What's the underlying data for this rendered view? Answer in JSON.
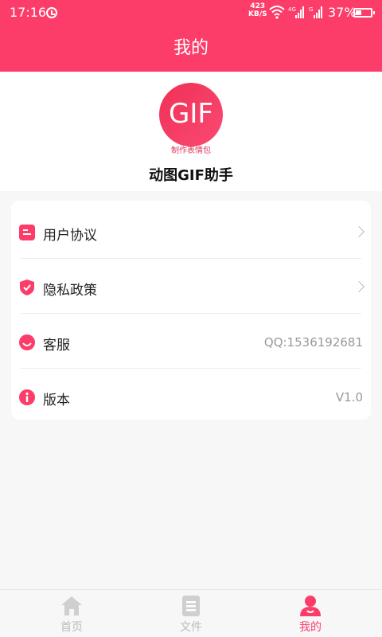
{
  "status_bar": {
    "time": "17:16",
    "net_speed_value": "423",
    "net_speed_unit": "KB/S",
    "signal_1_label": "4G",
    "signal_2_label": "G",
    "battery": "37%"
  },
  "header": {
    "title": "我的"
  },
  "profile": {
    "logo_text": "GIF",
    "logo_caption": "制作表情包",
    "app_name": "动图GIF助手"
  },
  "menu": {
    "items": [
      {
        "label": "用户协议",
        "value": "",
        "icon": "document-icon",
        "has_chevron": true
      },
      {
        "label": "隐私政策",
        "value": "",
        "icon": "shield-icon",
        "has_chevron": true
      },
      {
        "label": "客服",
        "value": "QQ:1536192681",
        "icon": "smile-icon",
        "has_chevron": false
      },
      {
        "label": "版本",
        "value": "V1.0",
        "icon": "info-icon",
        "has_chevron": false
      }
    ]
  },
  "tab_bar": {
    "tabs": [
      {
        "label": "首页",
        "icon": "home-icon",
        "active": false
      },
      {
        "label": "文件",
        "icon": "file-icon",
        "active": false
      },
      {
        "label": "我的",
        "icon": "user-icon",
        "active": true
      }
    ]
  },
  "colors": {
    "accent": "#fc3d6a",
    "inactive": "#bbbbbb",
    "background": "#f7f7f7"
  }
}
